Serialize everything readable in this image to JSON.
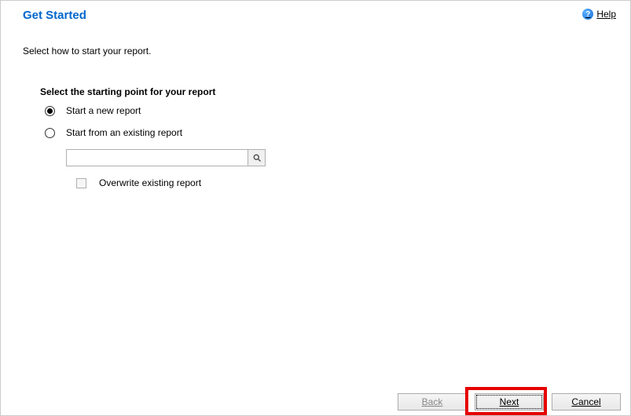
{
  "header": {
    "title": "Get Started",
    "help_label": "Help"
  },
  "intro_text": "Select how to start your report.",
  "section_label": "Select the starting point for your report",
  "options": {
    "new_report": "Start a new report",
    "existing_report": "Start from an existing report"
  },
  "search": {
    "value": "",
    "placeholder": ""
  },
  "overwrite_label": "Overwrite existing report",
  "buttons": {
    "back": "Back",
    "next": "Next",
    "cancel": "Cancel"
  }
}
